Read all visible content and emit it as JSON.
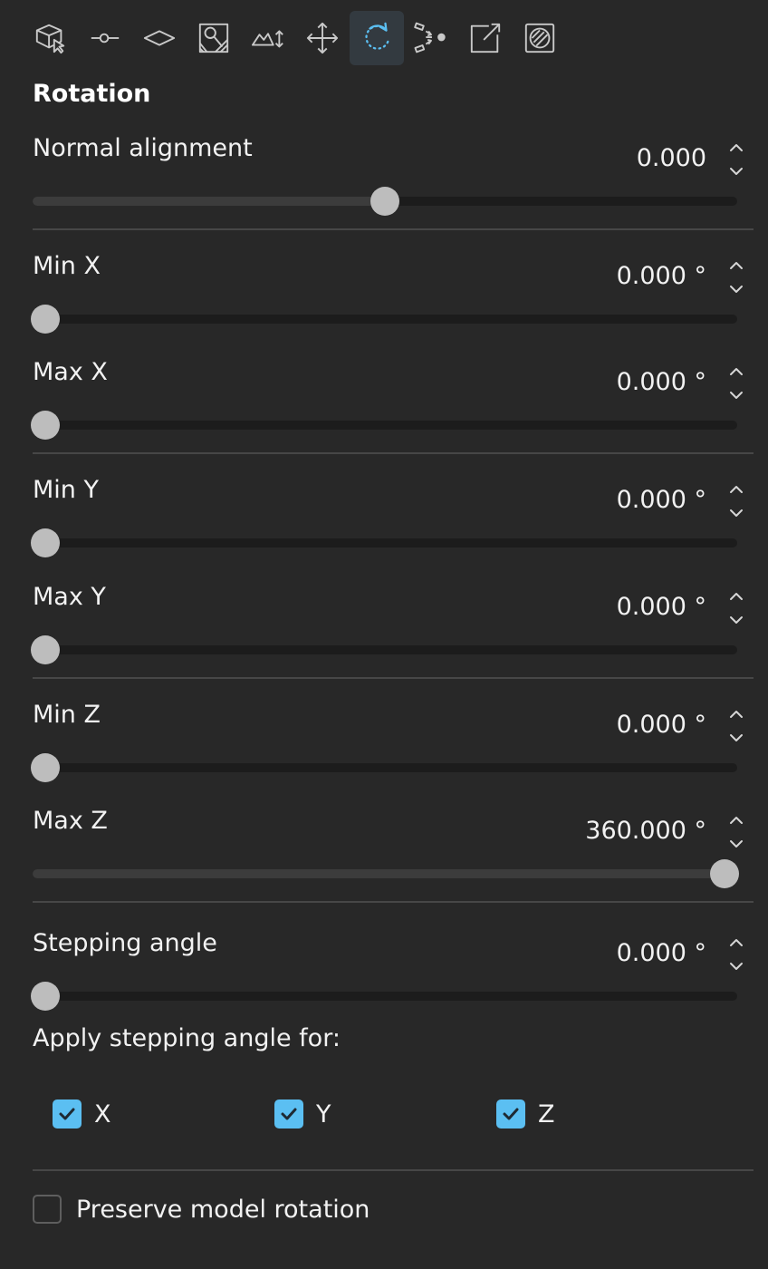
{
  "toolbar": {
    "tools": [
      {
        "icon": "cube-select-icon",
        "active": false
      },
      {
        "icon": "point-line-icon",
        "active": false
      },
      {
        "icon": "plane-icon",
        "active": false
      },
      {
        "icon": "texture-brush-icon",
        "active": false
      },
      {
        "icon": "terrain-height-icon",
        "active": false
      },
      {
        "icon": "move-arrows-icon",
        "active": false
      },
      {
        "icon": "rotate-icon",
        "active": true
      },
      {
        "icon": "scatter-icon",
        "active": false
      },
      {
        "icon": "export-icon",
        "active": false
      },
      {
        "icon": "mask-icon",
        "active": false
      }
    ],
    "active_color": "#5bbff2"
  },
  "section": {
    "title": "Rotation"
  },
  "rows": [
    {
      "key": "normal_alignment",
      "label": "Normal alignment",
      "value": "0.000",
      "fraction": 0.5
    },
    {
      "key": "min_x",
      "label": "Min X",
      "value": "0.000 °",
      "fraction": 0.0
    },
    {
      "key": "max_x",
      "label": "Max X",
      "value": "0.000 °",
      "fraction": 0.0
    },
    {
      "key": "min_y",
      "label": "Min Y",
      "value": "0.000 °",
      "fraction": 0.0
    },
    {
      "key": "max_y",
      "label": "Max Y",
      "value": "0.000 °",
      "fraction": 0.0
    },
    {
      "key": "min_z",
      "label": "Min Z",
      "value": "0.000 °",
      "fraction": 0.0
    },
    {
      "key": "max_z",
      "label": "Max Z",
      "value": "360.000 °",
      "fraction": 1.0
    },
    {
      "key": "stepping_angle",
      "label": "Stepping angle",
      "value": "0.000 °",
      "fraction": 0.0
    }
  ],
  "stepping": {
    "apply_label": "Apply stepping angle for:",
    "axes": [
      {
        "label": "X",
        "checked": true
      },
      {
        "label": "Y",
        "checked": true
      },
      {
        "label": "Z",
        "checked": true
      }
    ]
  },
  "preserve": {
    "label": "Preserve model rotation",
    "checked": false
  },
  "colors": {
    "background": "#282828",
    "accent": "#5bbff2",
    "thumb": "#bdbdbd"
  }
}
